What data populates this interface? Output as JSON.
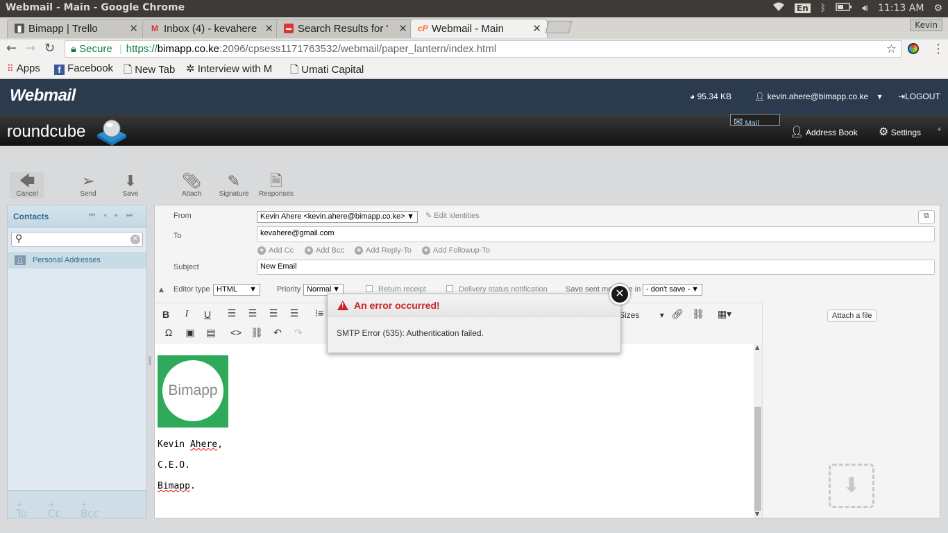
{
  "os": {
    "window_title": "Webmail - Main - Google Chrome",
    "lang": "En",
    "clock": "11:13 AM"
  },
  "browser": {
    "tabs": [
      {
        "label": "Bimapp | Trello",
        "icon": "trello-icon"
      },
      {
        "label": "Inbox (4) - kevahere",
        "icon": "gmail-icon"
      },
      {
        "label": "Search Results for '",
        "icon": "search-results-icon"
      },
      {
        "label": "Webmail - Main",
        "icon": "cpanel-icon"
      }
    ],
    "profile": "Kevin",
    "secure_label": "Secure",
    "url_scheme": "https://",
    "url_host": "bimapp.co.ke",
    "url_path": ":2096/cpsess1171763532/webmail/paper_lantern/index.html",
    "bookmarks": [
      "Apps",
      "Facebook",
      "New Tab",
      "Interview with M",
      "Umati Capital"
    ]
  },
  "webmail": {
    "logo": "Webmail",
    "disk_usage": "95.34 KB",
    "user": "kevin.ahere@bimapp.co.ke",
    "logout": "LOGOUT"
  },
  "roundcube": {
    "logo": "roundcube",
    "nav": [
      "Mail",
      "Address Book",
      "Settings"
    ]
  },
  "toolbar": {
    "cancel": "Cancel",
    "send": "Send",
    "save": "Save",
    "attach": "Attach",
    "signature": "Signature",
    "responses": "Responses"
  },
  "contacts": {
    "title": "Contacts",
    "group": "Personal Addresses",
    "footer": [
      "To",
      "Cc",
      "Bcc"
    ]
  },
  "compose": {
    "from_label": "From",
    "from_value": "Kevin Ahere <kevin.ahere@bimapp.co.ke>",
    "edit_identities": "Edit identities",
    "to_label": "To",
    "to_value": "kevahere@gmail.com",
    "add_links": [
      "Add Cc",
      "Add Bcc",
      "Add Reply-To",
      "Add Followup-To"
    ],
    "subject_label": "Subject",
    "subject_value": "New Email",
    "editor_type_label": "Editor type",
    "editor_type_value": "HTML",
    "priority_label": "Priority",
    "priority_value": "Normal",
    "return_receipt": "Return receipt",
    "delivery_status": "Delivery status notification",
    "save_sent_label": "Save sent message in",
    "save_sent_value": "- don't save -",
    "font_sizes": "Sizes",
    "attach_file": "Attach a file",
    "logo_text": "Bimapp",
    "signature_lines": [
      "Kevin Ahere,",
      "C.E.O.",
      "Bimapp."
    ]
  },
  "error": {
    "title": "An error occurred!",
    "message": "SMTP Error (535): Authentication failed."
  },
  "colors": {
    "header_navy": "#2b3b4d",
    "error_red": "#cc2222",
    "logo_green": "#2eaa5a",
    "contacts_bg": "#dfe9ef"
  }
}
